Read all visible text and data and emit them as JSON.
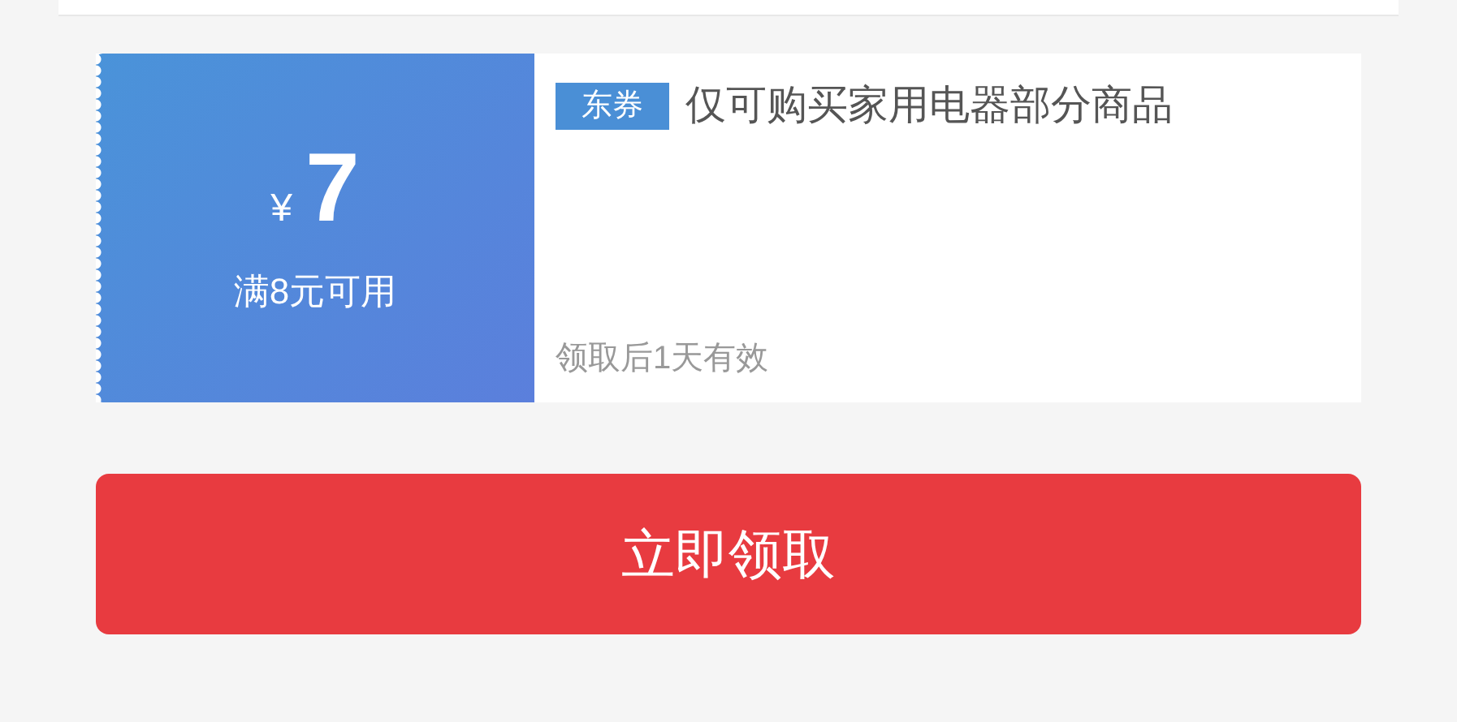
{
  "coupon": {
    "currency": "¥",
    "amount": "7",
    "condition": "满8元可用",
    "tag": "东券",
    "title": "仅可购买家用电器部分商品",
    "validity": "领取后1天有效"
  },
  "claim_button": {
    "label": "立即领取"
  }
}
